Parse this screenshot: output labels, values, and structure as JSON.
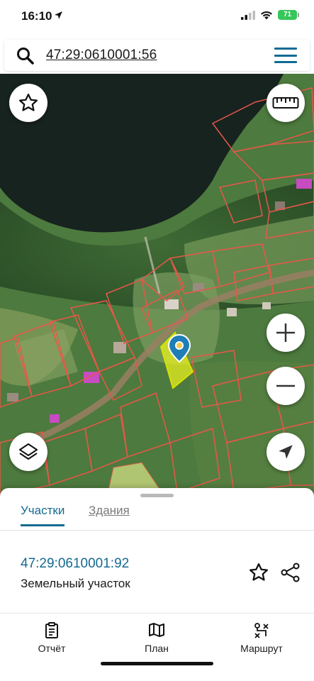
{
  "status_bar": {
    "time": "16:10",
    "battery": "71"
  },
  "search": {
    "query": "47:29:0610001:56"
  },
  "map_controls": {
    "favorite": "star-icon",
    "ruler": "ruler-icon",
    "zoom_in": "plus-icon",
    "zoom_out": "minus-icon",
    "layers": "layers-icon",
    "locate": "navigation-arrow-icon"
  },
  "tabs": [
    {
      "label": "Участки",
      "active": true
    },
    {
      "label": "Здания",
      "active": false
    }
  ],
  "parcel": {
    "number": "47:29:0610001:92",
    "type": "Земельный участок"
  },
  "bottom_nav": [
    {
      "label": "Отчёт",
      "icon": "report-clipboard-icon"
    },
    {
      "label": "План",
      "icon": "map-plan-icon"
    },
    {
      "label": "Маршрут",
      "icon": "route-icon"
    }
  ],
  "colors": {
    "accent": "#146a90",
    "menu": "#0f6a93",
    "parcel_border": "#e8574a",
    "selected_parcel": "#e8f020",
    "battery": "#35c759"
  }
}
